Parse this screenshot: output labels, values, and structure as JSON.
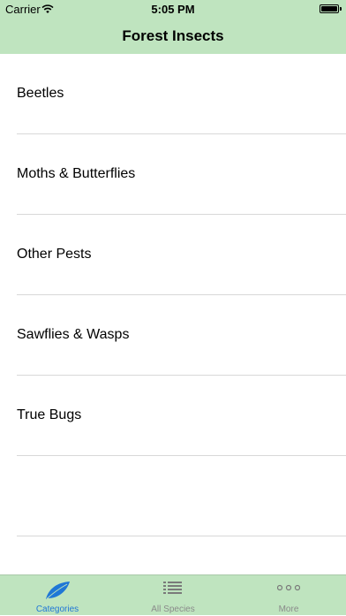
{
  "status_bar": {
    "carrier": "Carrier",
    "time": "5:05 PM",
    "wifi_icon": "wifi-icon",
    "battery_icon": "battery-icon"
  },
  "nav": {
    "title": "Forest Insects"
  },
  "categories": [
    {
      "label": "Beetles"
    },
    {
      "label": "Moths & Butterflies"
    },
    {
      "label": "Other Pests"
    },
    {
      "label": "Sawflies & Wasps"
    },
    {
      "label": "True Bugs"
    },
    {
      "label": ""
    }
  ],
  "tabbar": {
    "tabs": [
      {
        "label": "Categories",
        "icon": "leaf-icon",
        "active": true
      },
      {
        "label": "All Species",
        "icon": "list-icon",
        "active": false
      },
      {
        "label": "More",
        "icon": "more-icon",
        "active": false
      }
    ]
  },
  "colors": {
    "bar_background": "#bfe4bf",
    "active_tab": "#1f77d6",
    "inactive_tab": "#8a8a8a"
  }
}
